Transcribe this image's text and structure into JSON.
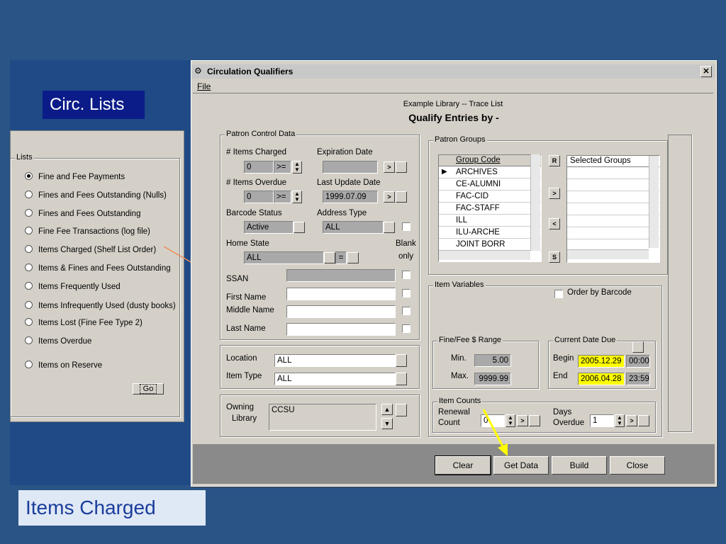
{
  "left": {
    "title": "Circ. Lists",
    "group_label": "Lists",
    "items": [
      {
        "label": "Fine and Fee Payments",
        "selected": true
      },
      {
        "label": "Fines and Fees Outstanding (Nulls)",
        "selected": false
      },
      {
        "label": "Fines and Fees Outstanding",
        "selected": false
      },
      {
        "label": "Fine Fee Transactions (log file)",
        "selected": false
      },
      {
        "label": "Items Charged  (Shelf List Order)",
        "selected": false
      },
      {
        "label": "Items & Fines and Fees Outstanding",
        "selected": false
      },
      {
        "label": "Items Frequently Used",
        "selected": false
      },
      {
        "label": "Items Infrequently Used  (dusty books)",
        "selected": false
      },
      {
        "label": "Items Lost  (Fine Fee Type 2)",
        "selected": false
      },
      {
        "label": "Items Overdue",
        "selected": false
      },
      {
        "label": "Items on Reserve",
        "selected": false
      }
    ],
    "go_button": "Go"
  },
  "caption": "Items Charged",
  "dialog": {
    "title": "Circulation Qualifiers",
    "menu_file": "File",
    "header_line1": "Example Library -- Trace List",
    "header_line2": "Qualify Entries by -",
    "patron_control": {
      "label": "Patron Control Data",
      "items_charged_label": "# Items Charged",
      "items_charged_value": "0",
      "items_charged_op": ">=",
      "expiration_label": "Expiration Date",
      "expiration_value": "",
      "items_overdue_label": "# Items Overdue",
      "items_overdue_value": "0",
      "items_overdue_op": ">=",
      "last_update_label": "Last Update Date",
      "last_update_value": "1999.07.09",
      "barcode_status_label": "Barcode Status",
      "barcode_status_value": "Active",
      "address_type_label": "Address Type",
      "address_type_value": "ALL",
      "home_state_label": "Home State",
      "home_state_value": "ALL",
      "home_state_op": "=",
      "blank_only_label1": "Blank",
      "blank_only_label2": "only",
      "ssan_label": "SSAN",
      "first_name_label": "First Name",
      "middle_name_label": "Middle Name",
      "last_name_label": "Last Name"
    },
    "location_label": "Location",
    "location_value": "ALL",
    "item_type_label": "Item Type",
    "item_type_value": "ALL",
    "owning_library_label1": "Owning",
    "owning_library_label2": "Library",
    "owning_library_value": "CCSU",
    "patron_groups": {
      "label": "Patron Groups",
      "col_header": "Group Code",
      "rows": [
        "ARCHIVES",
        "CE-ALUMNI",
        "FAC-CID",
        "FAC-STAFF",
        "ILL",
        "ILU-ARCHE",
        "JOINT BORR"
      ],
      "selected_header": "Selected Groups",
      "btn_r": "R",
      "btn_add": ">",
      "btn_remove": "<",
      "btn_s": "S"
    },
    "item_variables": {
      "label": "Item Variables",
      "order_by_barcode": "Order by Barcode",
      "fine_range_label": "Fine/Fee $ Range",
      "min_label": "Min.",
      "min_value": "5.00",
      "max_label": "Max.",
      "max_value": "9999.99",
      "date_due_label": "Current Date Due",
      "begin_label": "Begin",
      "begin_date": "2005.12.29",
      "begin_time": "00:00",
      "end_label": "End",
      "end_date": "2006.04.28",
      "end_time": "23:59",
      "item_counts_label": "Item Counts",
      "renewal_label1": "Renewal",
      "renewal_label2": "Count",
      "renewal_value": "0",
      "days_overdue_label1": "Days",
      "days_overdue_label2": "Overdue",
      "days_overdue_value": "1"
    },
    "buttons": {
      "clear": "Clear",
      "get_data": "Get Data",
      "build": "Build",
      "close": "Close"
    }
  }
}
